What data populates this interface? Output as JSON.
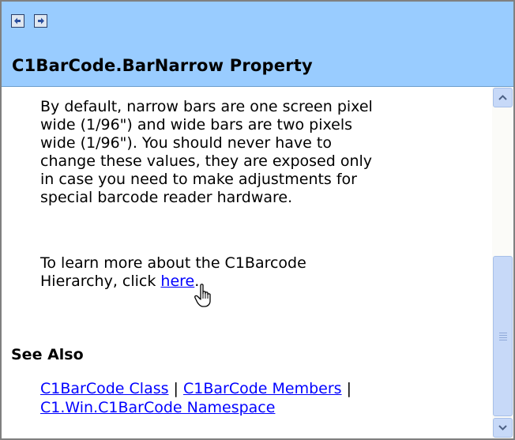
{
  "header": {
    "title": "C1BarCode.BarNarrow Property",
    "back_icon": "back-arrow-icon",
    "forward_icon": "forward-arrow-icon"
  },
  "content": {
    "paragraph1": "By default, narrow bars are one screen pixel\nwide (1/96\") and wide bars are two pixels\nwide (1/96\"). You should never have to\nchange these values, they are exposed only\nin case you need to make adjustments for\nspecial barcode reader hardware.",
    "paragraph2_prefix": "To learn more about the C1Barcode\nHierarchy, click ",
    "paragraph2_link": "here",
    "paragraph2_suffix": "."
  },
  "see_also": {
    "heading": "See Also",
    "link1": "C1BarCode Class",
    "separator1": " | ",
    "link2": "C1BarCode Members",
    "separator2": " |",
    "link3": "C1.Win.C1BarCode Namespace"
  },
  "colors": {
    "header_bg": "#99ccff",
    "link": "#0000ff",
    "scrollbar": "#c7d9f8"
  },
  "scrollbar": {
    "scroll_position": 0.55
  }
}
